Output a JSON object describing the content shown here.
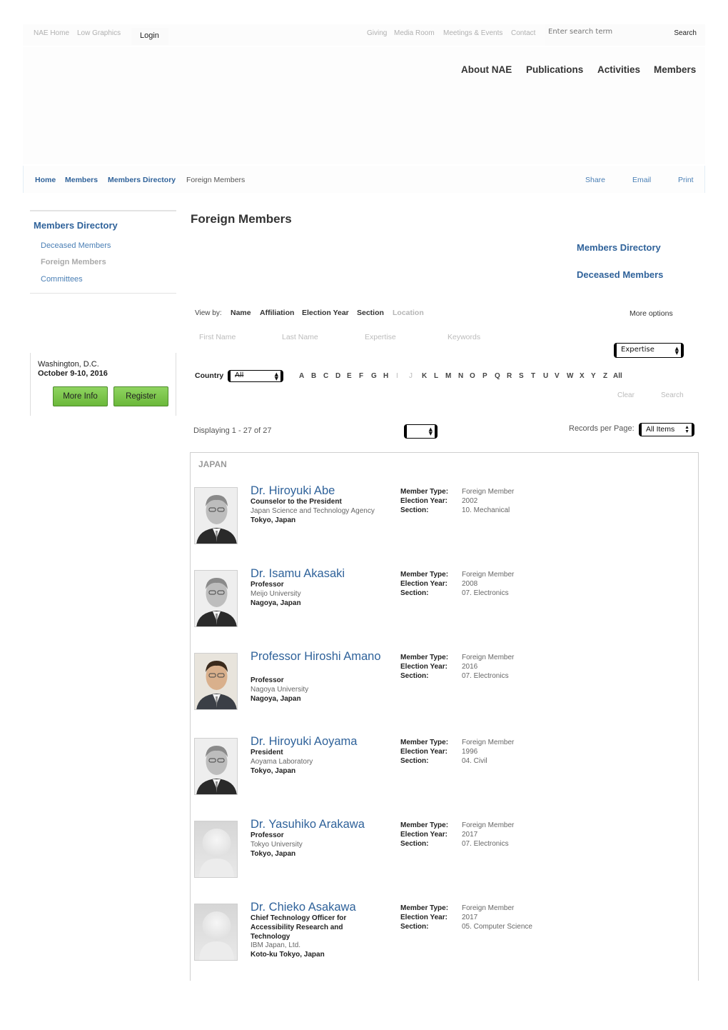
{
  "utility": {
    "links": [
      "NAE Home",
      "Low Graphics"
    ],
    "login_label": "Login",
    "right_links": [
      "Giving",
      "Media Room",
      "Meetings & Events",
      "Contact"
    ],
    "search_placeholder": "Enter search term",
    "search_label": "Search"
  },
  "main_nav": [
    "About NAE",
    "Publications",
    "Activities",
    "Members"
  ],
  "breadcrumb": {
    "items": [
      "Home",
      "Members",
      "Members Directory"
    ],
    "current": "Foreign Members"
  },
  "page_actions": [
    "Share",
    "Email",
    "Print"
  ],
  "sidebar": {
    "title": "Members Directory",
    "items": [
      {
        "label": "Deceased Members",
        "active": false
      },
      {
        "label": "Foreign Members",
        "active": true
      },
      {
        "label": "Committees",
        "active": false
      }
    ]
  },
  "event": {
    "location": "Washington, D.C.",
    "date": "October 9-10, 2016",
    "more_info_label": "More Info",
    "register_label": "Register"
  },
  "page_title": "Foreign Members",
  "right_links": [
    "Members Directory",
    "Deceased Members"
  ],
  "view_by": {
    "label": "View by:",
    "options": [
      {
        "label": "Name",
        "enabled": true
      },
      {
        "label": "Affiliation",
        "enabled": true
      },
      {
        "label": "Election Year",
        "enabled": true
      },
      {
        "label": "Section",
        "enabled": true
      },
      {
        "label": "Location",
        "enabled": false
      }
    ],
    "more_options": "More options"
  },
  "filters": {
    "first_name_placeholder": "First Name",
    "last_name_placeholder": "Last Name",
    "expertise_placeholder": "Expertise",
    "keywords_placeholder": "Keywords",
    "expertise_select": "Expertise",
    "country_label": "Country",
    "country_select": "All",
    "letters": [
      "A",
      "B",
      "C",
      "D",
      "E",
      "F",
      "G",
      "H",
      "I",
      "J",
      "K",
      "L",
      "M",
      "N",
      "O",
      "P",
      "Q",
      "R",
      "S",
      "T",
      "U",
      "V",
      "W",
      "X",
      "Y",
      "Z",
      "All"
    ],
    "disabled_letters": [
      "I",
      "J"
    ],
    "clear_label": "Clear",
    "search_label": "Search"
  },
  "results_bar": {
    "displaying": "Displaying 1 - 27 of 27",
    "page_select": "",
    "records_per_page_label": "Records per Page:",
    "records_per_page": "All Items"
  },
  "results": {
    "country": "JAPAN",
    "labels": {
      "member_type": "Member Type:",
      "election_year": "Election Year:",
      "section": "Section:"
    },
    "members": [
      {
        "name": "Dr. Hiroyuki Abe",
        "title": "Counselor to the President",
        "affiliation": "Japan Science and Technology Agency",
        "location": "Tokyo, Japan",
        "member_type": "Foreign Member",
        "election_year": "2002",
        "section": "10. Mechanical",
        "photo": "portrait-bw"
      },
      {
        "name": "Dr. Isamu Akasaki",
        "title": "Professor",
        "affiliation": "Meijo University",
        "location": "Nagoya, Japan",
        "member_type": "Foreign Member",
        "election_year": "2008",
        "section": "07. Electronics",
        "photo": "portrait-bw"
      },
      {
        "name": "Professor Hiroshi Amano",
        "title": "Professor",
        "affiliation": "Nagoya University",
        "location": "Nagoya, Japan",
        "member_type": "Foreign Member",
        "election_year": "2016",
        "section": "07. Electronics",
        "photo": "portrait-color"
      },
      {
        "name": "Dr. Hiroyuki Aoyama",
        "title": "President",
        "affiliation": "Aoyama Laboratory",
        "location": "Tokyo, Japan",
        "member_type": "Foreign Member",
        "election_year": "1996",
        "section": "04. Civil",
        "photo": "portrait-bw"
      },
      {
        "name": "Dr. Yasuhiko Arakawa",
        "title": "Professor",
        "affiliation": "Tokyo University",
        "location": "Tokyo, Japan",
        "member_type": "Foreign Member",
        "election_year": "2017",
        "section": "07. Electronics",
        "photo": "placeholder"
      },
      {
        "name": "Dr. Chieko Asakawa",
        "title": "Chief Technology Officer for Accessibility Research and Technology",
        "affiliation": "IBM Japan, Ltd.",
        "location": "Koto-ku Tokyo, Japan",
        "member_type": "Foreign Member",
        "election_year": "2017",
        "section": "05. Computer Science",
        "photo": "placeholder"
      }
    ]
  },
  "colors": {
    "link_blue": "#2f629a",
    "light_link_blue": "#4a7fb5",
    "button_green": "#7cc64a"
  }
}
